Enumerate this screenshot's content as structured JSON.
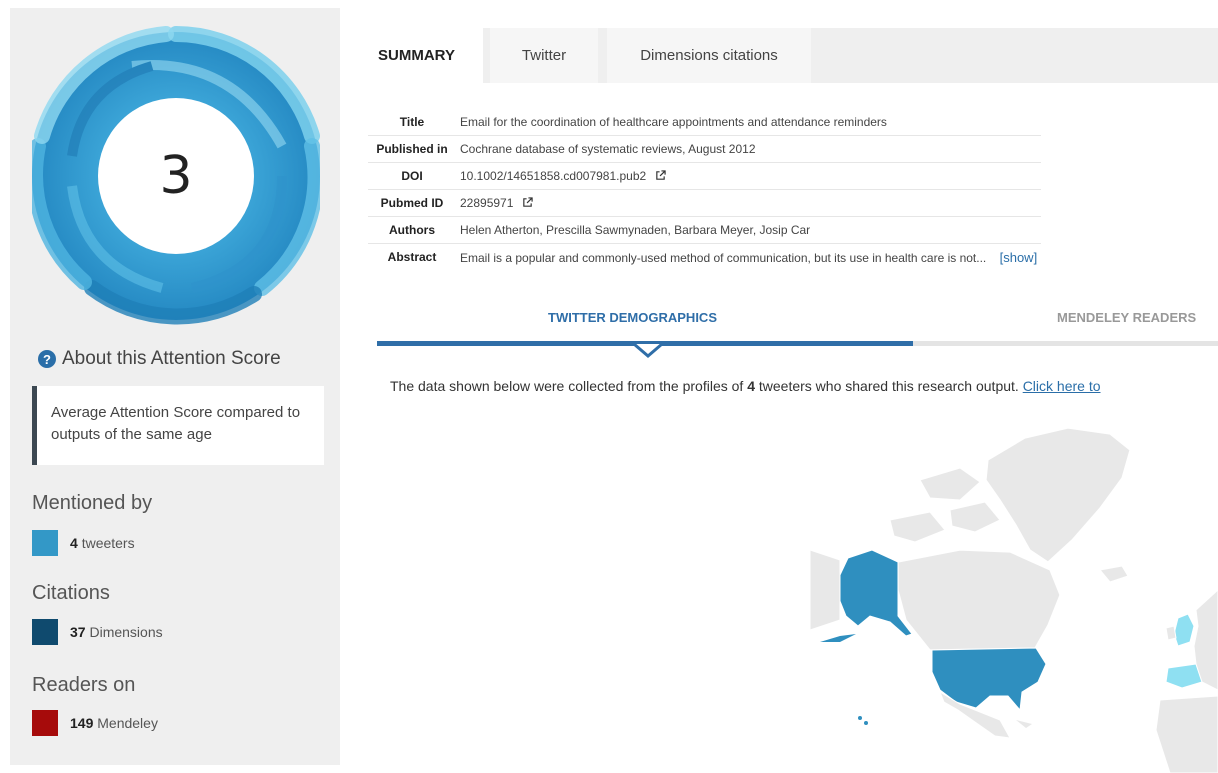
{
  "score": {
    "value": "3",
    "about_label": "About this Attention Score",
    "about_icon": "help-circle-icon",
    "description": "Average Attention Score compared to outputs of the same age",
    "ring_colors": [
      "#7cd0ec",
      "#3aa3d6",
      "#1f7fb8"
    ]
  },
  "mentioned": {
    "title": "Mentioned by",
    "count": "4",
    "label": "tweeters",
    "color": "#3398c7"
  },
  "citations": {
    "title": "Citations",
    "count": "37",
    "label": "Dimensions",
    "color": "#0f4a6e"
  },
  "readers": {
    "title": "Readers on",
    "count": "149",
    "label": "Mendeley",
    "color": "#a60b0b"
  },
  "tabs": [
    {
      "label": "SUMMARY",
      "active": true
    },
    {
      "label": "Twitter",
      "active": false
    },
    {
      "label": "Dimensions citations",
      "active": false
    }
  ],
  "meta": {
    "title_label": "Title",
    "title_value": "Email for the coordination of healthcare appointments and attendance reminders",
    "published_label": "Published in",
    "published_value": "Cochrane database of systematic reviews, August 2012",
    "doi_label": "DOI",
    "doi_value": "10.1002/14651858.cd007981.pub2",
    "pubmed_label": "Pubmed ID",
    "pubmed_value": "22895971",
    "authors_label": "Authors",
    "authors_value": "Helen Atherton, Prescilla Sawmynaden, Barbara Meyer, Josip Car",
    "abstract_label": "Abstract",
    "abstract_value": "Email is a popular and commonly-used method of communication, but its use in health care is not...",
    "show_label": "[show]"
  },
  "demographics": {
    "tab_twitter": "TWITTER DEMOGRAPHICS",
    "tab_mendeley": "MENDELEY READERS",
    "active_color": "#2f6ea8"
  },
  "intro": {
    "prefix": "The data shown below were collected from the profiles of ",
    "count": "4",
    "suffix": " tweeters who shared this research output. ",
    "link": "Click here to"
  },
  "map": {
    "highlight_dark": "#2f8fbf",
    "highlight_light": "#8fe0f2",
    "base": "#e8e8e8",
    "border": "#ffffff"
  }
}
